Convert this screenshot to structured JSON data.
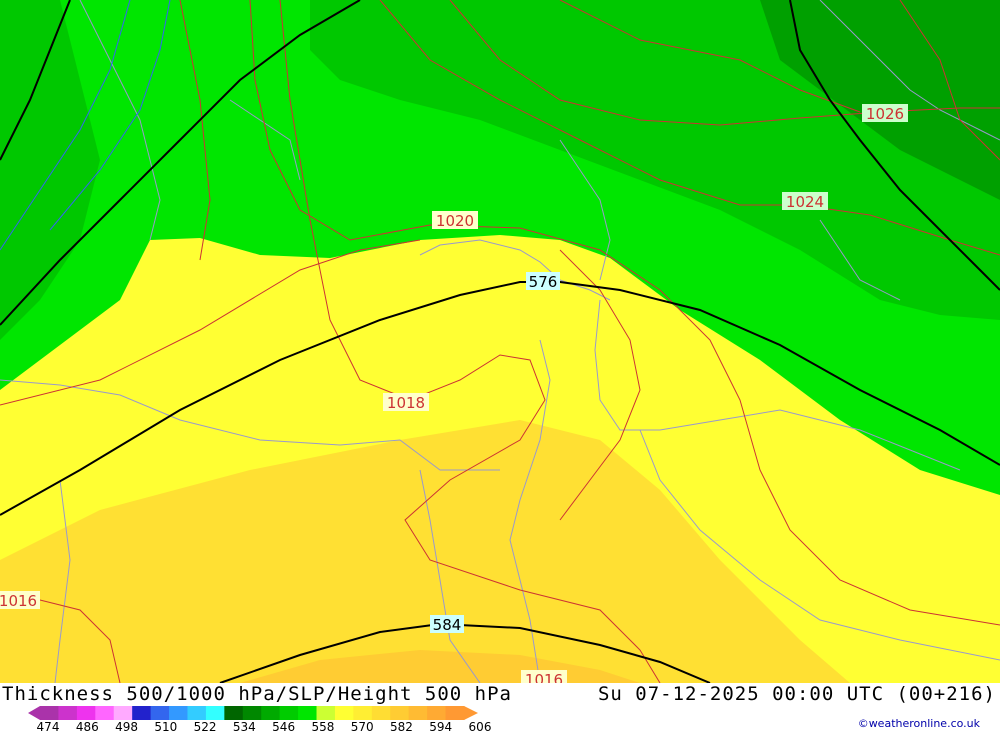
{
  "map": {
    "title": "Thickness 500/1000 hPa/SLP/Height 500 hPa",
    "datetime": "Su 07-12-2025 00:00 UTC (00+216)",
    "credit": "©weatheronline.co.uk",
    "colors": {
      "land_bright_green": "#00e600",
      "mid_green": "#00c800",
      "dark_green": "#00a000",
      "yellow": "#ffff33",
      "deep_yellow": "#ffe033",
      "orange_yellow": "#ffcc33",
      "isobar": "#cc3333",
      "height_contour": "#000000",
      "border": "#9999cc"
    },
    "labels": {
      "isobars": [
        "1026",
        "1024",
        "1020",
        "1018",
        "1016",
        "1016"
      ],
      "heights": [
        "576",
        "584"
      ]
    }
  },
  "colorbar": {
    "ticks": [
      "474",
      "486",
      "498",
      "510",
      "522",
      "534",
      "546",
      "558",
      "570",
      "582",
      "594",
      "606"
    ],
    "colors": [
      "#aa33aa",
      "#cc33cc",
      "#ee33ee",
      "#ff66ff",
      "#ffaaff",
      "#2222cc",
      "#3366ee",
      "#3399ff",
      "#33ccff",
      "#33ffff",
      "#006600",
      "#008800",
      "#00aa00",
      "#00cc00",
      "#00e600",
      "#ccff33",
      "#ffff33",
      "#ffee33",
      "#ffdd33",
      "#ffcc33",
      "#ffbb33",
      "#ffaa33",
      "#ff9933"
    ]
  }
}
